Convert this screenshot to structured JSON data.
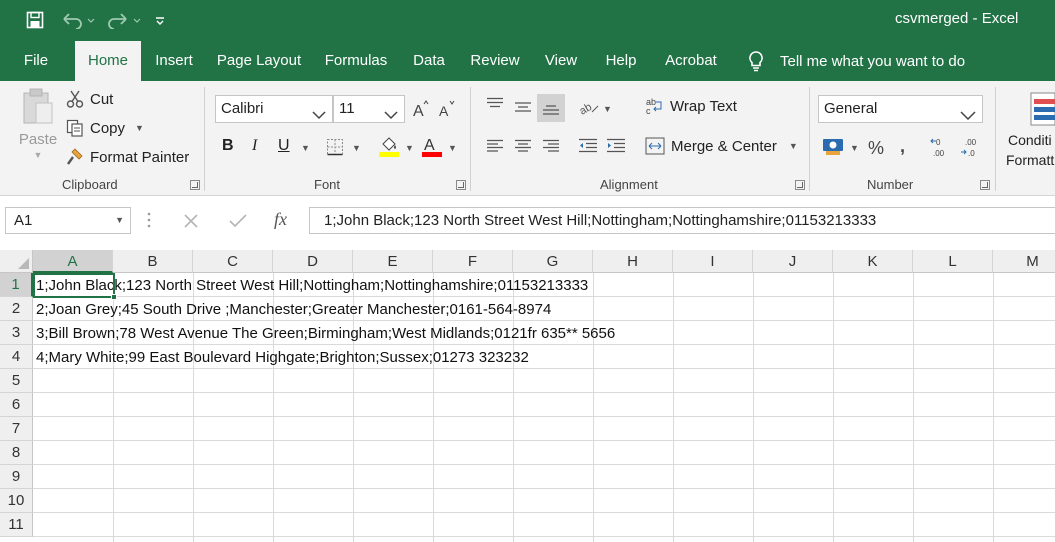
{
  "window": {
    "title": "csvmerged  -  Excel"
  },
  "tabs": [
    "File",
    "Home",
    "Insert",
    "Page Layout",
    "Formulas",
    "Data",
    "Review",
    "View",
    "Help",
    "Acrobat"
  ],
  "active_tab": "Home",
  "tell_me": "Tell me what you want to do",
  "clipboard": {
    "paste": "Paste",
    "cut": "Cut",
    "copy": "Copy",
    "format_painter": "Format Painter",
    "label": "Clipboard"
  },
  "font": {
    "name": "Calibri",
    "size": "11",
    "label": "Font",
    "bold": "B",
    "italic": "I",
    "underline": "U",
    "fill_color": "#ffff00",
    "font_color": "#ff0000"
  },
  "alignment": {
    "wrap_text": "Wrap Text",
    "merge_center": "Merge & Center",
    "label": "Alignment"
  },
  "number": {
    "format": "General",
    "label": "Number"
  },
  "styles": {
    "conditional_formatting": "Conditi",
    "conditional_formatting_line2": "Formatt"
  },
  "formula_bar": {
    "name_box": "A1",
    "fx": "fx",
    "content": "1;John Black;123 North Street West Hill;Nottingham;Nottinghamshire;01153213333"
  },
  "sheet": {
    "columns": [
      "A",
      "B",
      "C",
      "D",
      "E",
      "F",
      "G",
      "H",
      "I",
      "J",
      "K",
      "L",
      "M"
    ],
    "rows": [
      "1",
      "2",
      "3",
      "4",
      "5",
      "6",
      "7",
      "8",
      "9",
      "10",
      "11"
    ],
    "cells": [
      "1;John Black;123 North Street West Hill;Nottingham;Nottinghamshire;01153213333",
      "2;Joan Grey;45 South Drive ;Manchester;Greater Manchester;0161-564-8974",
      "3;Bill Brown;78 West Avenue The Green;Birmingham;West Midlands;0121fr 635** 5656",
      "4;Mary White;99 East Boulevard Highgate;Brighton;Sussex;01273 323232"
    ],
    "selected_cell": "A1"
  },
  "colors": {
    "accent": "#217346"
  }
}
